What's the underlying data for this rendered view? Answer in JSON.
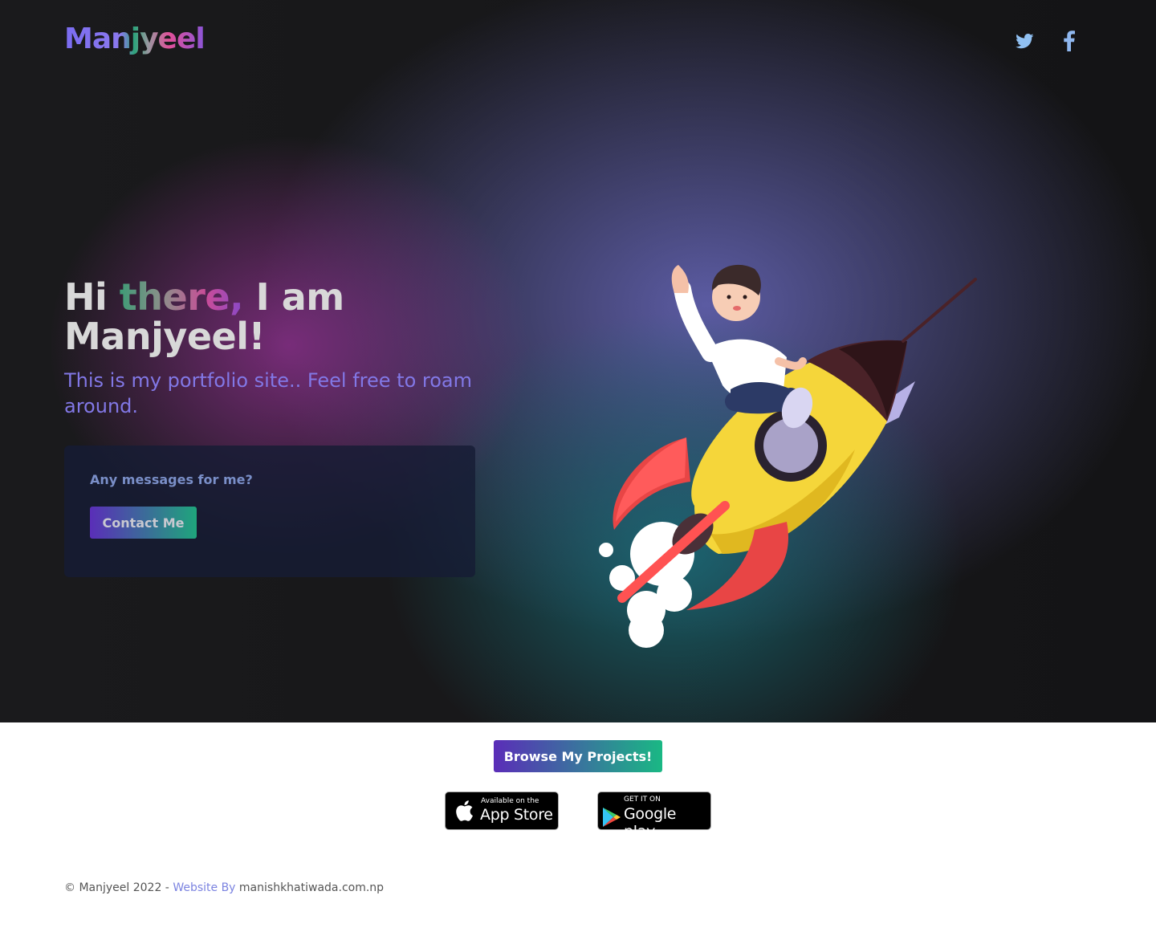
{
  "header": {
    "logo": "Manjyeel",
    "social": [
      {
        "name": "twitter",
        "icon": "twitter-icon",
        "color": "#90c0f2"
      },
      {
        "name": "facebook",
        "icon": "facebook-icon",
        "color": "#8fb7ef"
      }
    ]
  },
  "hero": {
    "headline_hi": "Hi ",
    "headline_there": "there,",
    "headline_iam": " I am",
    "headline_name": "Manjyeel!",
    "subline": "This is my portfolio site.. Feel free to roam around.",
    "card": {
      "title": "Any messages for me?",
      "button": "Contact Me"
    },
    "illustration": "rocket-boy-illustration"
  },
  "projects": {
    "browse_button": "Browse My Projects!"
  },
  "stores": {
    "apple_small": "Available on the",
    "apple_big": "App Store",
    "google_small": "GET IT ON",
    "google_big": "Google play"
  },
  "footer": {
    "copyright": "© Manjyeel 2022 - ",
    "website_by": "Website By",
    "site": " manishkhatiwada.com.np"
  },
  "colors": {
    "accent_purple": "#5a2db8",
    "accent_green": "#1ab884",
    "subline": "#8278e6"
  }
}
